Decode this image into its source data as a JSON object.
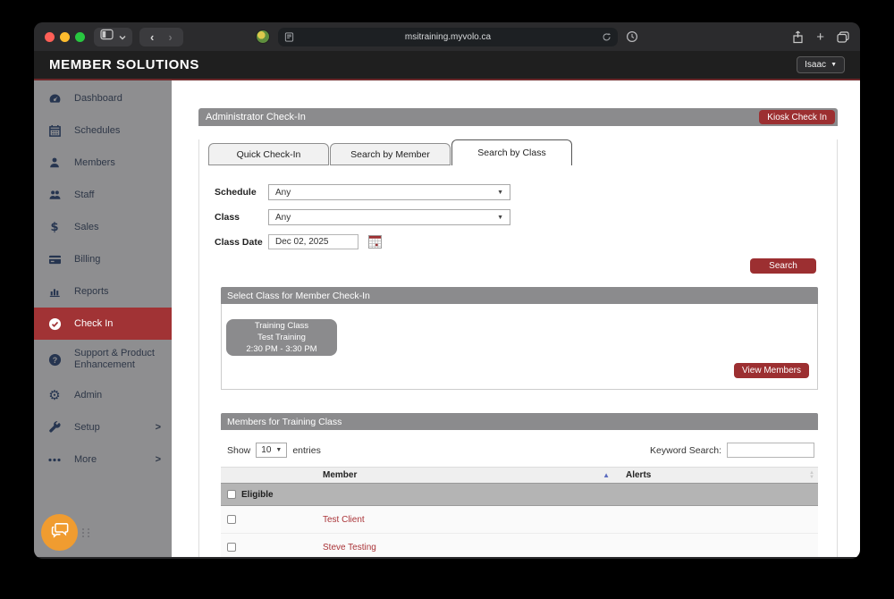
{
  "browser": {
    "url": "msitraining.myvolo.ca"
  },
  "header": {
    "brand": "MEMBER SOLUTIONS",
    "user": "Isaac"
  },
  "sidebar": {
    "items": [
      {
        "label": "Dashboard",
        "icon": "gauge-icon"
      },
      {
        "label": "Schedules",
        "icon": "calendar-icon"
      },
      {
        "label": "Members",
        "icon": "member-icon"
      },
      {
        "label": "Staff",
        "icon": "staff-icon"
      },
      {
        "label": "Sales",
        "icon": "dollar-icon"
      },
      {
        "label": "Billing",
        "icon": "credit-card-icon"
      },
      {
        "label": "Reports",
        "icon": "bar-chart-icon"
      },
      {
        "label": "Check In",
        "icon": "check-circle-icon",
        "active": true
      },
      {
        "label": "Support & Product Enhancement",
        "icon": "question-circle-icon"
      },
      {
        "label": "Admin",
        "icon": "gear-icon"
      },
      {
        "label": "Setup",
        "icon": "wrench-icon",
        "has_submenu": true
      },
      {
        "label": "More",
        "icon": "ellipsis-icon",
        "has_submenu": true
      }
    ],
    "submenu_arrow": ">"
  },
  "main": {
    "panel_title": "Administrator Check-In",
    "kiosk_button": "Kiosk Check In",
    "tabs": [
      {
        "label": "Quick Check-In"
      },
      {
        "label": "Search by Member"
      },
      {
        "label": "Search by Class",
        "active": true
      }
    ],
    "form": {
      "schedule_label": "Schedule",
      "schedule_value": "Any",
      "class_label": "Class",
      "class_value": "Any",
      "class_date_label": "Class Date",
      "class_date_value": "Dec 02, 2025",
      "search_button": "Search"
    },
    "select_class": {
      "title": "Select Class for Member Check-In",
      "card": {
        "line1": "Training Class",
        "line2": "Test Training",
        "line3": "2:30 PM - 3:30 PM"
      },
      "view_members_button": "View Members"
    },
    "members": {
      "title": "Members for Training Class",
      "show_label": "Show",
      "show_value": "10",
      "entries_label": "entries",
      "keyword_label": "Keyword Search:",
      "columns": {
        "member": "Member",
        "alerts": "Alerts"
      },
      "group_label": "Eligible",
      "rows": [
        {
          "member": "Test Client"
        },
        {
          "member": "Steve Testing"
        }
      ]
    }
  },
  "colors": {
    "accent_red": "#9c2f31",
    "active_red": "#a13335",
    "bar_gray": "#8b8b8d",
    "sidebar_gray": "#8e8e90",
    "link_red": "#aa3438",
    "chat_orange": "#f09c30",
    "divider_maroon": "#6e2a2c"
  }
}
